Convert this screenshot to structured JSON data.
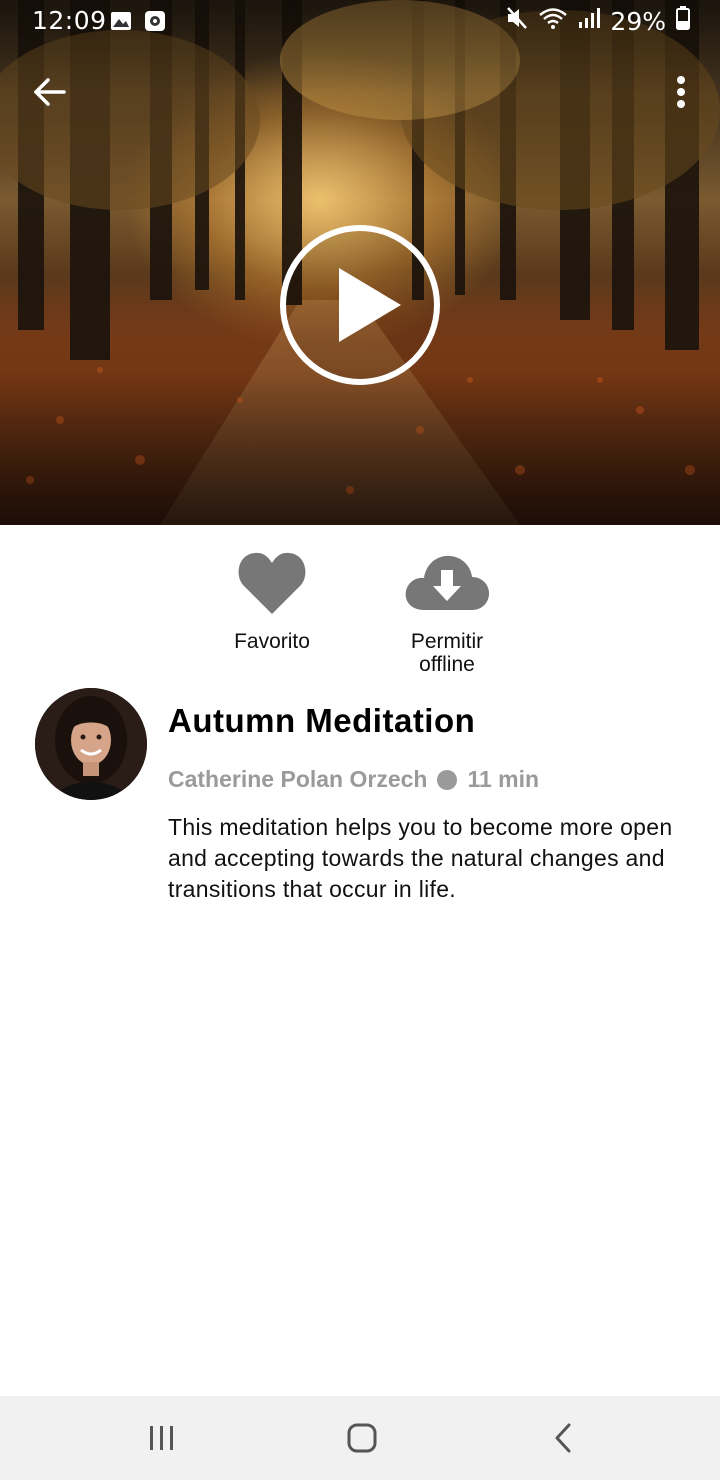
{
  "status_bar": {
    "time": "12:09",
    "battery": "29%",
    "icons": [
      "image-icon",
      "app-icon",
      "mute-icon",
      "wifi-icon",
      "signal-icon",
      "battery-icon"
    ]
  },
  "top_nav": {
    "back_icon": "arrow-left-icon",
    "more_icon": "more-vertical-icon"
  },
  "hero": {
    "play_icon": "play-circle-icon"
  },
  "actions": {
    "favorite_label": "Favorito",
    "offline_label_line1": "Permitir",
    "offline_label_line2": "offline"
  },
  "meditation": {
    "title": "Autumn Meditation",
    "author": "Catherine Polan Orzech",
    "duration": "11 min",
    "description": "This meditation helps you to become more open and accepting towards the natural changes and transitions that occur in life."
  },
  "nav_bar": {
    "icons": [
      "recents-icon",
      "home-icon",
      "back-icon"
    ]
  },
  "colors": {
    "icon_gray": "#777777",
    "meta_gray": "#9a9a9a",
    "nav_bg": "#f1f1f1"
  }
}
